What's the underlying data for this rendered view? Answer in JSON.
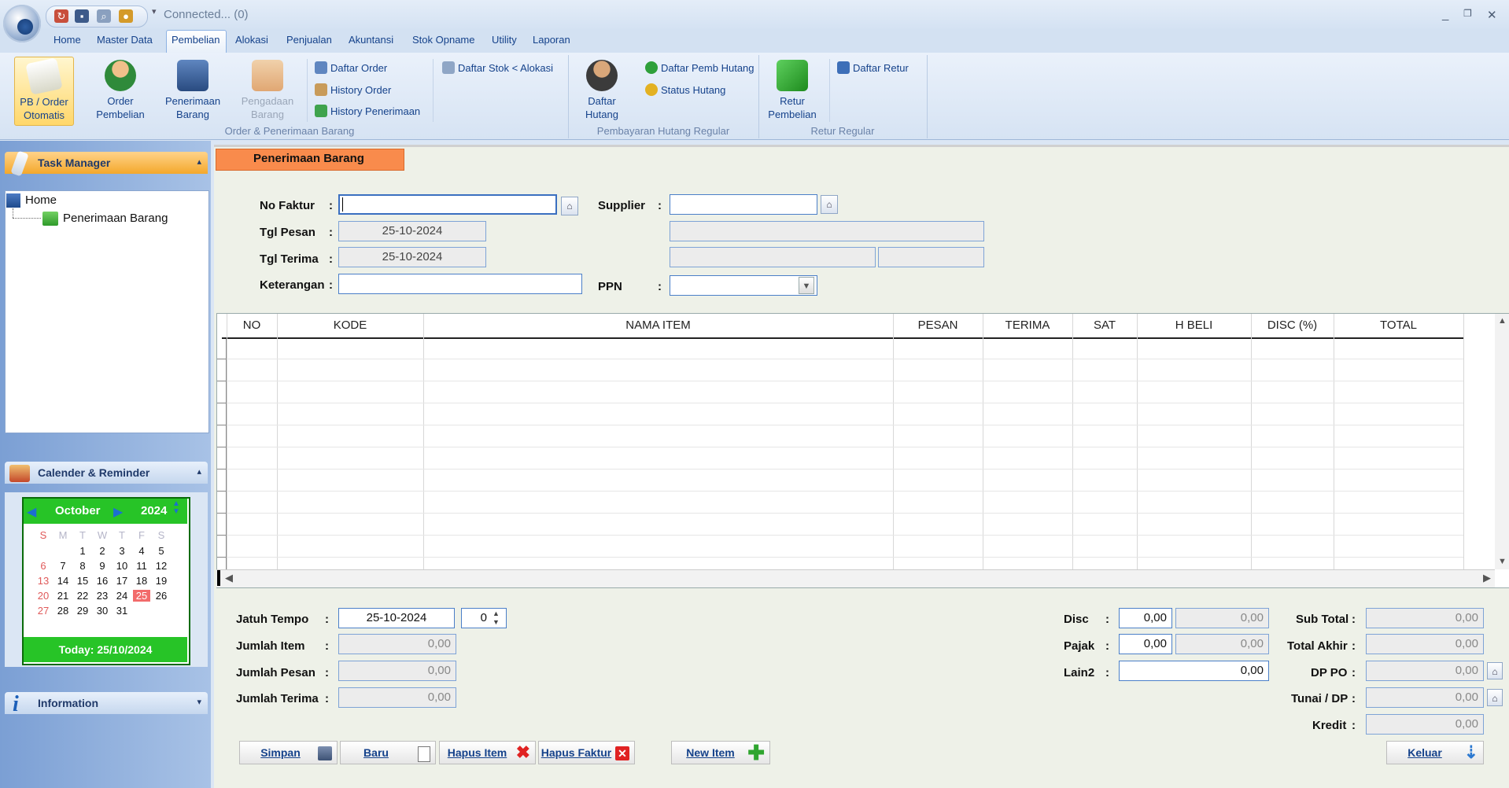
{
  "titlebar": {
    "connection": "Connected... (0)",
    "minimize": "_",
    "restore": "❐",
    "close": "✕"
  },
  "tabs": [
    "Home",
    "Master Data",
    "Pembelian",
    "Alokasi",
    "Penjualan",
    "Akuntansi",
    "Stok Opname",
    "Utility",
    "Laporan"
  ],
  "ribbon": {
    "pb_order": [
      "PB / Order",
      "Otomatis"
    ],
    "order_pembelian": [
      "Order",
      "Pembelian"
    ],
    "penerimaan_barang": [
      "Penerimaan",
      "Barang"
    ],
    "pengadaan_barang": [
      "Pengadaan",
      "Barang"
    ],
    "daftar_order": "Daftar Order",
    "history_order": "History Order",
    "history_penerimaan": "History Penerimaan",
    "daftar_stok": "Daftar Stok < Alokasi",
    "daftar_hutang": [
      "Daftar",
      "Hutang"
    ],
    "daftar_pemb_hutang": "Daftar Pemb Hutang",
    "status_hutang": "Status Hutang",
    "retur_pembelian": [
      "Retur",
      "Pembelian"
    ],
    "daftar_retur": "Daftar Retur",
    "group_order": "Order & Penerimaan Barang",
    "group_hutang": "Pembayaran Hutang Regular",
    "group_retur": "Retur Regular"
  },
  "left": {
    "task_manager": "Task Manager",
    "tree_home": "Home",
    "tree_item": "Penerimaan Barang",
    "calendar_title": "Calender & Reminder",
    "month": "October",
    "year": "2024",
    "weekdays": [
      "S",
      "M",
      "T",
      "W",
      "T",
      "F",
      "S"
    ],
    "weeks": [
      [
        "",
        "",
        "1",
        "2",
        "3",
        "4",
        "5"
      ],
      [
        "6",
        "7",
        "8",
        "9",
        "10",
        "11",
        "12"
      ],
      [
        "13",
        "14",
        "15",
        "16",
        "17",
        "18",
        "19"
      ],
      [
        "20",
        "21",
        "22",
        "23",
        "24",
        "25",
        "26"
      ],
      [
        "27",
        "28",
        "29",
        "30",
        "31",
        "",
        ""
      ]
    ],
    "today": "Today: 25/10/2024",
    "information": "Information"
  },
  "form": {
    "title": "Penerimaan Barang",
    "no_faktur_label": "No Faktur",
    "no_faktur": "",
    "supplier_label": "Supplier",
    "supplier": "",
    "tgl_pesan_label": "Tgl Pesan",
    "tgl_pesan": "25-10-2024",
    "tgl_terima_label": "Tgl Terima",
    "tgl_terima": "25-10-2024",
    "keterangan_label": "Keterangan",
    "keterangan": "",
    "ppn_label": "PPN",
    "colon": ":"
  },
  "grid": {
    "columns": [
      "NO",
      "KODE",
      "NAMA ITEM",
      "PESAN",
      "TERIMA",
      "SAT",
      "H BELI",
      "DISC (%)",
      "TOTAL"
    ]
  },
  "footer": {
    "jatuh_tempo_label": "Jatuh Tempo",
    "jatuh_tempo": "25-10-2024",
    "jatuh_tempo_days": "0",
    "jumlah_item_label": "Jumlah Item",
    "jumlah_item": "0,00",
    "jumlah_pesan_label": "Jumlah Pesan",
    "jumlah_pesan": "0,00",
    "jumlah_terima_label": "Jumlah Terima",
    "jumlah_terima": "0,00",
    "disc_label": "Disc",
    "disc_pct": "0,00",
    "disc_value": "0,00",
    "pajak_label": "Pajak",
    "pajak_pct": "0,00",
    "pajak_value": "0,00",
    "lain2_label": "Lain2",
    "lain2": "0,00",
    "sub_total_label": "Sub Total",
    "sub_total": "0,00",
    "total_akhir_label": "Total Akhir",
    "total_akhir": "0,00",
    "dp_po_label": "DP PO",
    "dp_po": "0,00",
    "tunai_label": "Tunai / DP",
    "tunai": "0,00",
    "kredit_label": "Kredit",
    "kredit": "0,00"
  },
  "buttons": {
    "simpan": "Simpan",
    "baru": "Baru",
    "hapus_item": "Hapus Item",
    "hapus_faktur": "Hapus Faktur",
    "new_item": "New Item",
    "keluar": "Keluar"
  },
  "colors": {
    "accent": "#f98b4c",
    "calendar": "#27c427",
    "ribbon_text": "#15428b"
  }
}
